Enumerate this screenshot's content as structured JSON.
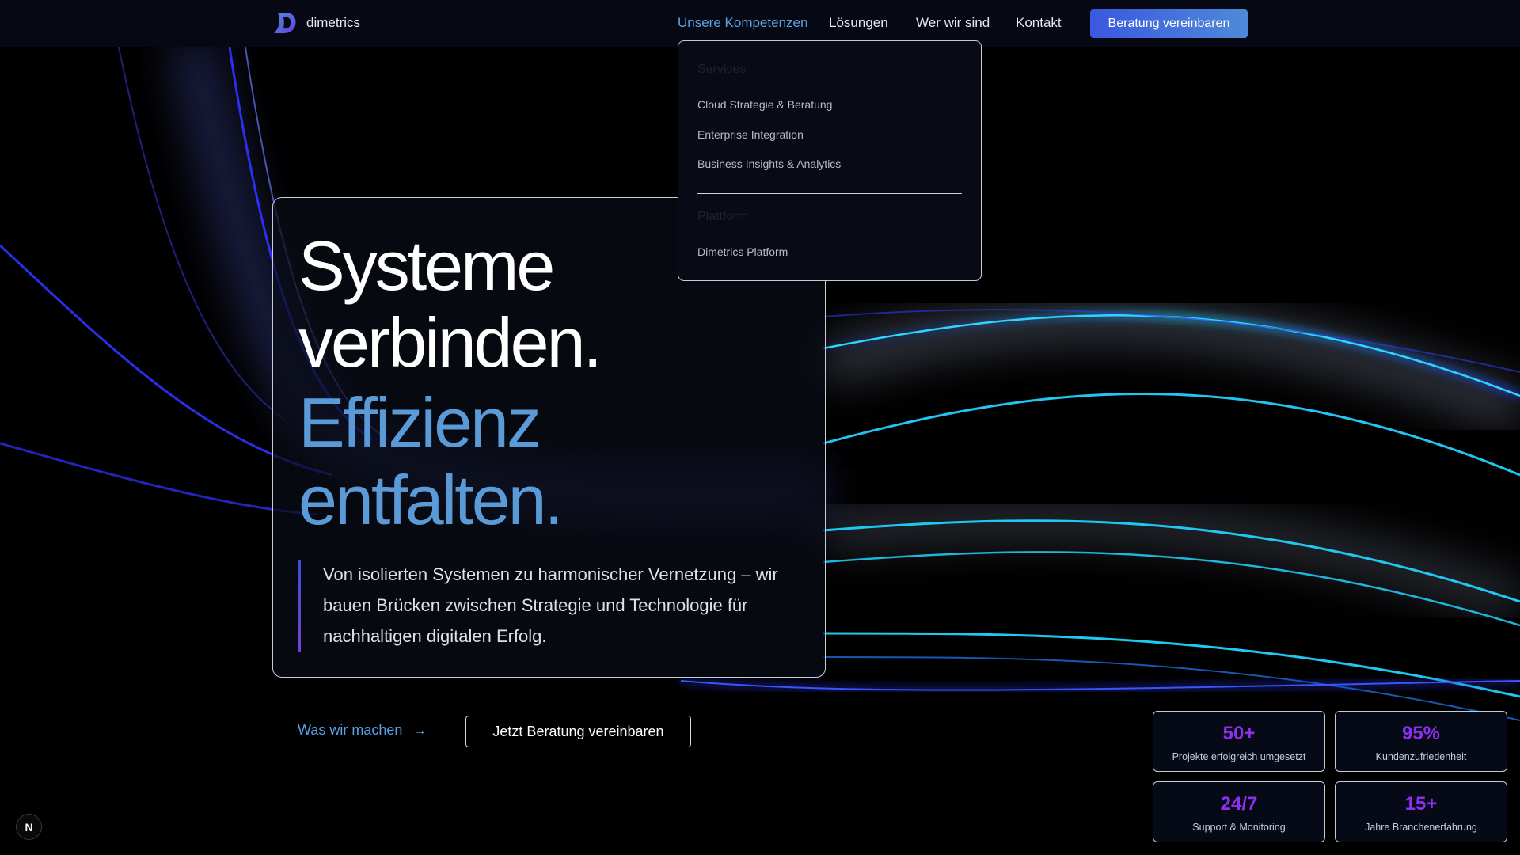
{
  "brand": {
    "name": "dimetrics"
  },
  "nav": {
    "links": [
      {
        "label": "Unsere Kompetenzen",
        "active": true
      },
      {
        "label": "Lösungen",
        "active": false
      },
      {
        "label": "Wer wir sind",
        "active": false
      },
      {
        "label": "Kontakt",
        "active": false
      }
    ],
    "cta": "Beratung vereinbaren"
  },
  "dropdown": {
    "services_heading": "Services",
    "services": [
      "Cloud Strategie & Beratung",
      "Enterprise Integration",
      "Business Insights & Analytics"
    ],
    "platform_heading": "Plattform",
    "platform": [
      "Dimetrics Platform"
    ]
  },
  "hero": {
    "line1": "Systeme",
    "line2": "verbinden.",
    "line3": "Effizienz",
    "line4": "entfalten.",
    "subtitle": "Von isolierten Systemen zu harmonischer Vernetzung – wir bauen Brücken zwischen Strategie und Technologie für nachhaltigen digitalen Erfolg."
  },
  "actions": {
    "link_label": "Was wir machen",
    "link_arrow": "→",
    "button_label": "Jetzt Beratung vereinbaren"
  },
  "stats": [
    {
      "value": "50+",
      "label": "Projekte erfolgreich umgesetzt"
    },
    {
      "value": "95%",
      "label": "Kundenzufriedenheit"
    },
    {
      "value": "24/7",
      "label": "Support & Monitoring"
    },
    {
      "value": "15+",
      "label": "Jahre Branchenerfahrung"
    }
  ],
  "badge": {
    "letter": "N"
  },
  "colors": {
    "accent_blue": "#5aa2e6",
    "stat_purple": "#8e2ff0",
    "cta_gradient_start": "#3a58e0",
    "cta_gradient_end": "#4f8ad8",
    "wave_cyan": "#1fc8f0",
    "wave_blue": "#2440f0"
  }
}
